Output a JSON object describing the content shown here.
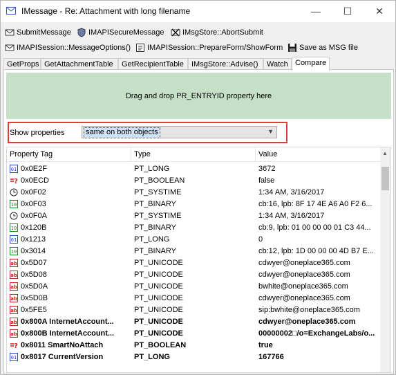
{
  "window": {
    "title": "IMessage  -  Re: Attachment with long filename",
    "minimize": "—",
    "maximize": "☐",
    "close": "✕"
  },
  "toolbar1": [
    {
      "label": "SubmitMessage",
      "icon": "submit-icon"
    },
    {
      "label": "IMAPISecureMessage",
      "icon": "secure-icon"
    },
    {
      "label": "IMsgStore::AbortSubmit",
      "icon": "abort-icon"
    }
  ],
  "toolbar2": [
    {
      "label": "IMAPISession::MessageOptions()",
      "icon": "options-icon"
    },
    {
      "label": "IMAPISession::PrepareForm/ShowForm",
      "icon": "form-icon"
    },
    {
      "label": "Save as MSG file",
      "icon": "save-icon"
    }
  ],
  "tabs": [
    "GetProps",
    "GetAttachmentTable",
    "GetRecipientTable",
    "IMsgStore::Advise()",
    "Watch",
    "Compare"
  ],
  "active_tab": "Compare",
  "dropzone": {
    "text": "Drag and drop PR_ENTRYID property here"
  },
  "show_properties": {
    "label": "Show properties",
    "value": "same on both objects"
  },
  "grid": {
    "headers": [
      "Property Tag",
      "Type",
      "Value"
    ],
    "rows": [
      {
        "icon": "numeric",
        "tag": "0x0E2F",
        "type": "PT_LONG",
        "value": "3672",
        "bold": false
      },
      {
        "icon": "boolean",
        "tag": "0x0ECD",
        "type": "PT_BOOLEAN",
        "value": "false",
        "bold": false
      },
      {
        "icon": "clock",
        "tag": "0x0F02",
        "type": "PT_SYSTIME",
        "value": "1:34 AM, 3/16/2017",
        "bold": false
      },
      {
        "icon": "binary",
        "tag": "0x0F03",
        "type": "PT_BINARY",
        "value": "cb:16, lpb: 8F 17 4E A6 A0 F2 6...",
        "bold": false
      },
      {
        "icon": "clock",
        "tag": "0x0F0A",
        "type": "PT_SYSTIME",
        "value": "1:34 AM, 3/16/2017",
        "bold": false
      },
      {
        "icon": "binary",
        "tag": "0x120B",
        "type": "PT_BINARY",
        "value": "cb:9, lpb: 01 00 00 00 01 C3 44...",
        "bold": false
      },
      {
        "icon": "numeric",
        "tag": "0x1213",
        "type": "PT_LONG",
        "value": "0",
        "bold": false
      },
      {
        "icon": "binary",
        "tag": "0x3014",
        "type": "PT_BINARY",
        "value": "cb:12, lpb: 1D 00 00 00 4D B7 E...",
        "bold": false
      },
      {
        "icon": "string",
        "tag": "0x5D07",
        "type": "PT_UNICODE",
        "value": "cdwyer@oneplace365.com",
        "bold": false
      },
      {
        "icon": "string",
        "tag": "0x5D08",
        "type": "PT_UNICODE",
        "value": "cdwyer@oneplace365.com",
        "bold": false
      },
      {
        "icon": "string",
        "tag": "0x5D0A",
        "type": "PT_UNICODE",
        "value": "bwhite@oneplace365.com",
        "bold": false
      },
      {
        "icon": "string",
        "tag": "0x5D0B",
        "type": "PT_UNICODE",
        "value": "cdwyer@oneplace365.com",
        "bold": false
      },
      {
        "icon": "string",
        "tag": "0x5FE5",
        "type": "PT_UNICODE",
        "value": "sip:bwhite@oneplace365.com",
        "bold": false
      },
      {
        "icon": "string",
        "tag": "0x800A  InternetAccount...",
        "type": "PT_UNICODE",
        "value": "cdwyer@oneplace365.com",
        "bold": true
      },
      {
        "icon": "string",
        "tag": "0x800B  InternetAccount...",
        "type": "PT_UNICODE",
        "value": "00000002□/o=ExchangeLabs/o...",
        "bold": true
      },
      {
        "icon": "boolean",
        "tag": "0x8011  SmartNoAttach",
        "type": "PT_BOOLEAN",
        "value": "true",
        "bold": true
      },
      {
        "icon": "numeric",
        "tag": "0x8017  CurrentVersion",
        "type": "PT_LONG",
        "value": "167766",
        "bold": true
      }
    ]
  },
  "colors": {
    "dropzone_bg": "#c6dfc7",
    "highlight_border": "#e03a3a",
    "icon_blue": "#1e46c8",
    "icon_green": "#1a8a1a",
    "icon_red": "#c81e1e"
  }
}
